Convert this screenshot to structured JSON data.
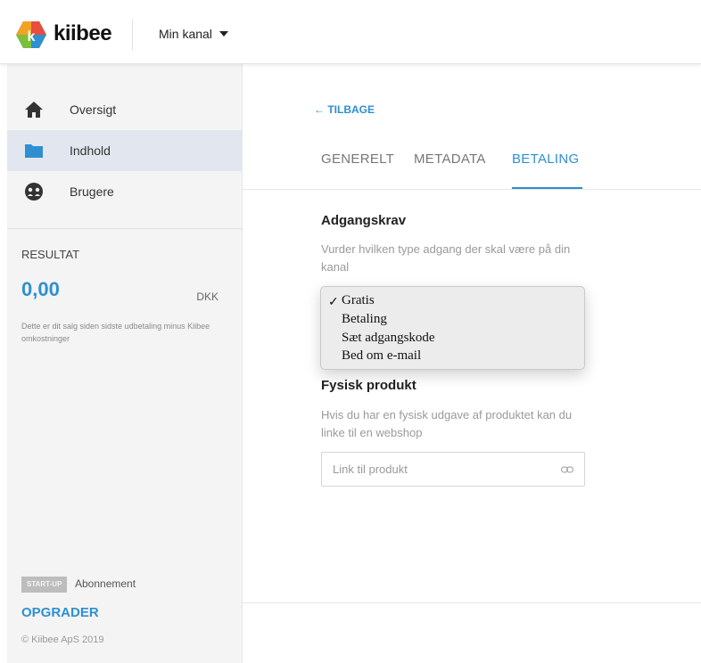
{
  "header": {
    "brand": "kiibee",
    "channel_label": "Min kanal"
  },
  "sidebar": {
    "items": [
      {
        "label": "Oversigt",
        "icon": "home-icon",
        "active": false
      },
      {
        "label": "Indhold",
        "icon": "folder-icon",
        "active": true
      },
      {
        "label": "Brugere",
        "icon": "users-icon",
        "active": false
      }
    ],
    "result": {
      "heading": "RESULTAT",
      "value": "0,00",
      "currency": "DKK",
      "note": "Dette er dit salg siden sidste udbetaling minus Kiibee omkostninger"
    },
    "plan": {
      "badge": "START-UP",
      "label": "Abonnement",
      "upgrade": "OPGRADER"
    },
    "copyright": "© Kiibee ApS 2019"
  },
  "main": {
    "back": "← TILBAGE",
    "tabs": [
      {
        "label": "GENERELT",
        "active": false
      },
      {
        "label": "METADATA",
        "active": false
      },
      {
        "label": "BETALING",
        "active": true
      }
    ],
    "access": {
      "title": "Adgangskrav",
      "description": "Vurder hvilken type adgang der skal være på din kanal",
      "options": [
        "Gratis",
        "Betaling",
        "Sæt adgangskode",
        "Bed om e-mail"
      ],
      "selected": "Gratis",
      "check": "✓"
    },
    "physical": {
      "title": "Fysisk produkt",
      "description": "Hvis du har en fysisk udgave af produktet kan du linke til en webshop",
      "placeholder": "Link til produkt",
      "value": ""
    }
  },
  "colors": {
    "accent": "#2f8fd1",
    "sidebar_bg": "#f4f4f4",
    "active_nav_bg": "#e2e7ef"
  }
}
